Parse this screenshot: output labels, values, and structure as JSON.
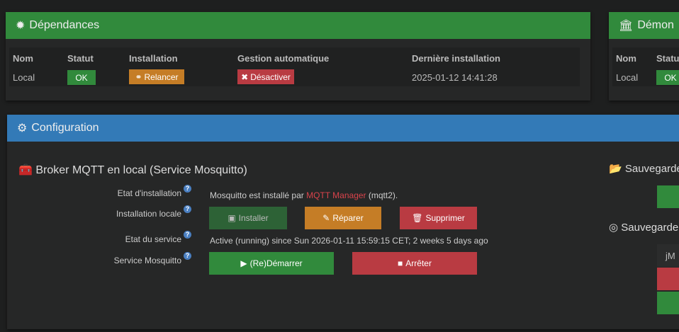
{
  "dependances": {
    "title": "Dépendances",
    "headers": [
      "Nom",
      "Statut",
      "Installation",
      "Gestion automatique",
      "Dernière installation"
    ],
    "row": {
      "nom": "Local",
      "statut": "OK",
      "installation": "Relancer",
      "gestion": "Désactiver",
      "derniere": "2025-01-12 14:41:28"
    }
  },
  "demon": {
    "title": "Démon",
    "headers": [
      "Nom",
      "Statut"
    ],
    "row": {
      "nom": "Local",
      "statut": "OK"
    }
  },
  "configuration": {
    "title": "Configuration",
    "broker": {
      "title": "Broker MQTT en local (Service Mosquitto)",
      "etat_installation_label": "Etat d'installation",
      "etat_installation_text": "Mosquitto est installé par ",
      "etat_installation_link": "MQTT Manager",
      "etat_installation_suffix": " (mqtt2).",
      "installation_locale_label": "Installation locale",
      "installer": "Installer",
      "reparer": "Réparer",
      "supprimer": "Supprimer",
      "etat_service_label": "Etat du service",
      "etat_service_text": "Active (running) since Sun 2026-01-11 15:59:15 CET; 2 weeks 5 days ago",
      "service_label": "Service Mosquitto",
      "demarrer": "(Re)Démarrer",
      "arreter": "Arrêter",
      "help": "?"
    },
    "sauvegarde1": "Sauvegarde",
    "sauvegarde2": "Sauvegarde",
    "jm_input": "jM"
  }
}
